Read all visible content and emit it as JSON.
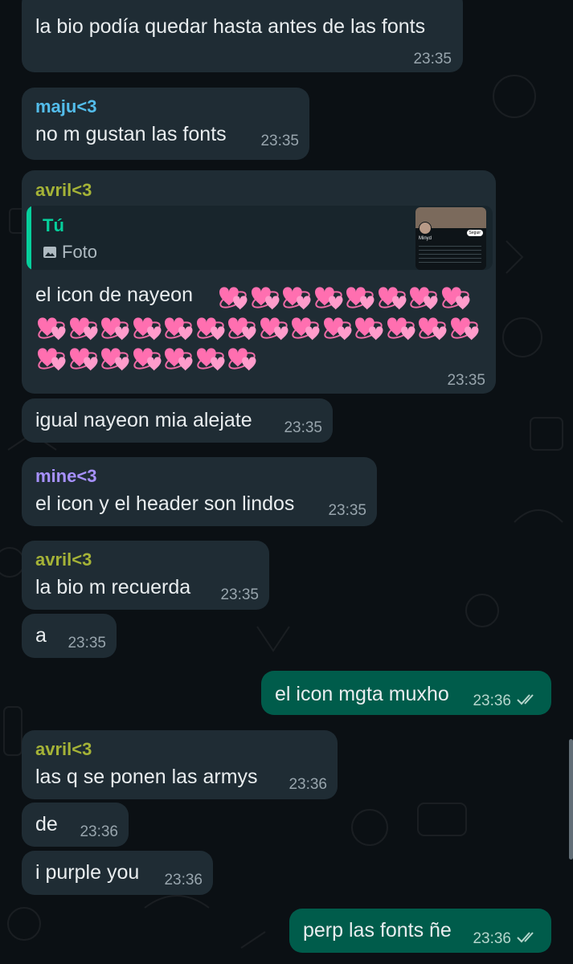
{
  "colors": {
    "background": "#0b1014",
    "incoming_bubble": "#1f2c34",
    "outgoing_bubble": "#005c4b",
    "quote_accent": "#06cf9c",
    "sender_maju": "#53bdeb",
    "sender_avril": "#a5b337",
    "sender_mine": "#a791ff",
    "timestamp": "#98a5ad",
    "read_ticks": "#b6d6cd"
  },
  "messages": [
    {
      "id": "m1",
      "direction": "incoming",
      "text": "la bio podía quedar hasta antes de las fonts",
      "time": "23:35"
    },
    {
      "id": "m2",
      "direction": "incoming",
      "sender": "maju<3",
      "text": "no m gustan las fonts",
      "time": "23:35"
    },
    {
      "id": "m3",
      "direction": "incoming",
      "sender": "avril<3",
      "reply": {
        "author": "Tú",
        "type_label": "Foto",
        "thumbnail_icon": "photo-thumbnail",
        "thumbnail_text": {
          "name": "Minyd",
          "button": "Seguir"
        }
      },
      "text": "el icon de nayeon",
      "emoji": "💞",
      "emoji_count": 29,
      "emoji_icon": "revolving-hearts-icon",
      "time": "23:35"
    },
    {
      "id": "m4",
      "direction": "incoming",
      "text": "igual nayeon mia alejate",
      "time": "23:35"
    },
    {
      "id": "m5",
      "direction": "incoming",
      "sender": "mine<3",
      "text": "el icon y el header son lindos",
      "time": "23:35"
    },
    {
      "id": "m6",
      "direction": "incoming",
      "sender": "avril<3",
      "text": "la bio m recuerda",
      "time": "23:35"
    },
    {
      "id": "m7",
      "direction": "incoming",
      "text": "a",
      "time": "23:35"
    },
    {
      "id": "m8",
      "direction": "outgoing",
      "text": "el icon mgta muxho",
      "time": "23:36",
      "status_icon": "double-check-icon"
    },
    {
      "id": "m9",
      "direction": "incoming",
      "sender": "avril<3",
      "text": "las q se ponen las armys",
      "time": "23:36"
    },
    {
      "id": "m10",
      "direction": "incoming",
      "text": "de",
      "time": "23:36"
    },
    {
      "id": "m11",
      "direction": "incoming",
      "text": "i purple you",
      "time": "23:36"
    },
    {
      "id": "m12",
      "direction": "outgoing",
      "text": "perp las fonts ñe",
      "time": "23:36",
      "status_icon": "double-check-icon"
    }
  ]
}
